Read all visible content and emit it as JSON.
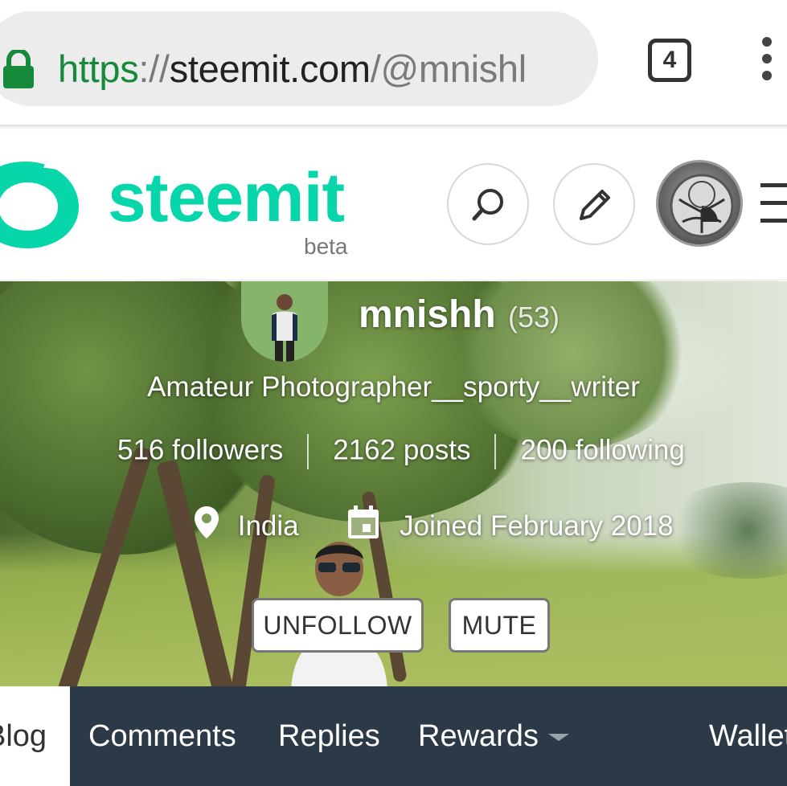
{
  "browser": {
    "url_scheme": "https",
    "url_separator": "://",
    "url_host": "steemit.com",
    "url_path": "/@mnishl",
    "tab_count": "4",
    "icons": [
      "lock-icon",
      "tab-switcher-icon",
      "more-vert-icon"
    ],
    "colors": {
      "secure": "#168a3a"
    }
  },
  "header": {
    "logo_text": "steemit",
    "beta_label": "beta",
    "icons": [
      "search-icon",
      "pencil-icon",
      "user-avatar",
      "menu-icon"
    ],
    "colors": {
      "brand": "#06d6a9"
    }
  },
  "profile": {
    "username": "mnishh",
    "reputation": "(53)",
    "about": "Amateur Photographer__sporty__writer",
    "followers": "516 followers",
    "posts": "2162 posts",
    "following": "200 following",
    "location": "India",
    "joined": "Joined February 2018",
    "unfollow_label": "UNFOLLOW",
    "mute_label": "MUTE"
  },
  "tabs": [
    {
      "label": "Blog",
      "active": true
    },
    {
      "label": "Comments",
      "active": false
    },
    {
      "label": "Replies",
      "active": false
    },
    {
      "label": "Rewards",
      "active": false,
      "dropdown": true
    },
    {
      "label": "Wallet",
      "active": false
    }
  ],
  "colors": {
    "tabbar": "#2b3a46"
  }
}
